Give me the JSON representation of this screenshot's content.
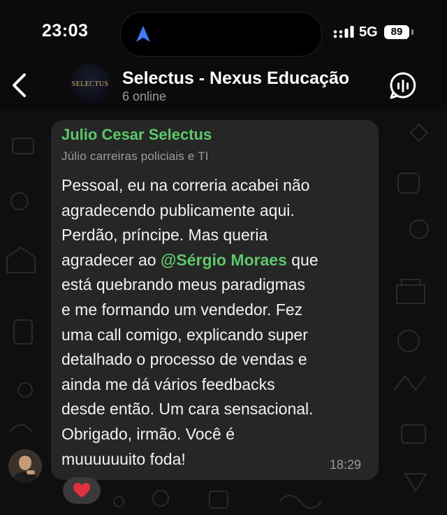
{
  "status_bar": {
    "time": "23:03",
    "network": "5G",
    "battery": "89",
    "location_icon": "location-arrow-icon",
    "signal_icon": "signal-bars-icon"
  },
  "header": {
    "group_name": "Selectus - Nexus Educação",
    "group_status": "6 online",
    "avatar_text": "SELECTUS",
    "back_icon": "chevron-left-icon",
    "call_icon": "voice-chat-icon"
  },
  "message": {
    "sender_name": "Julio Cesar Selectus",
    "sender_title": "Júlio carreiras policiais e TI",
    "lines": [
      "Pessoal, eu na correria acabei não",
      "agradecendo publicamente aqui.",
      "Perdão, príncipe. Mas queria"
    ],
    "mention_prefix": "agradecer ao ",
    "mention": "@Sérgio Moraes",
    "mention_suffix": " que",
    "lines_after": [
      "está quebrando meus paradigmas",
      "e me formando um vendedor. Fez",
      "uma call comigo, explicando super",
      "detalhado o processo de vendas e",
      "ainda me dá vários feedbacks",
      "desde então. Um cara sensacional.",
      "Obrigado, irmão. Você é",
      "muuuuuuito foda!"
    ],
    "time": "18:29",
    "reaction": "❤️"
  },
  "colors": {
    "accent_green": "#5dc86a",
    "bubble": "#262626",
    "background": "#0f0f0f"
  }
}
